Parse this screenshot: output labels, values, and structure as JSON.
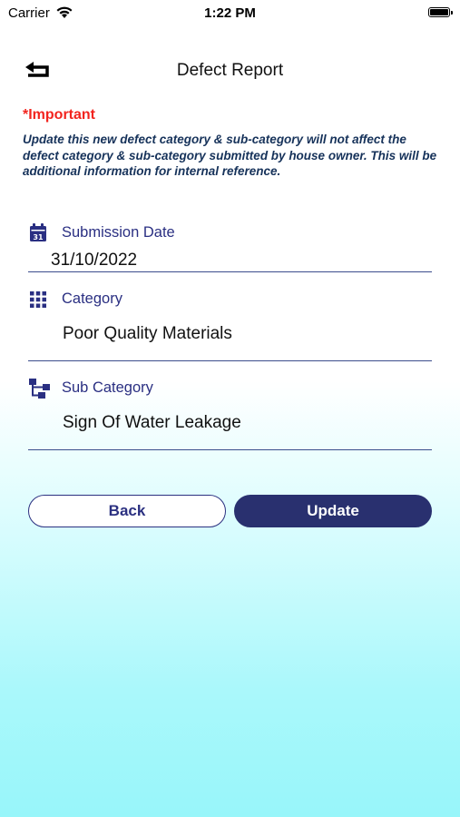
{
  "status_bar": {
    "carrier": "Carrier",
    "time": "1:22 PM"
  },
  "header": {
    "title": "Defect Report",
    "back_icon": "back-arrow-icon"
  },
  "notice": {
    "title": "*Important",
    "text": "Update this new defect category & sub-category will not affect the defect category & sub-category submitted by house owner. This will be additional information for internal reference."
  },
  "fields": {
    "submission_date": {
      "label": "Submission Date",
      "value": "31/10/2022",
      "icon": "calendar-icon"
    },
    "category": {
      "label": "Category",
      "value": "Poor Quality Materials",
      "icon": "grid-icon"
    },
    "sub_category": {
      "label": "Sub Category",
      "value": "Sign Of Water Leakage",
      "icon": "hierarchy-icon"
    }
  },
  "buttons": {
    "back": "Back",
    "update": "Update"
  },
  "colors": {
    "primary": "#29306f",
    "label": "#2a2f82",
    "important": "#f2241e",
    "notice_text": "#16325a",
    "gradient_end": "#98f6fa"
  }
}
